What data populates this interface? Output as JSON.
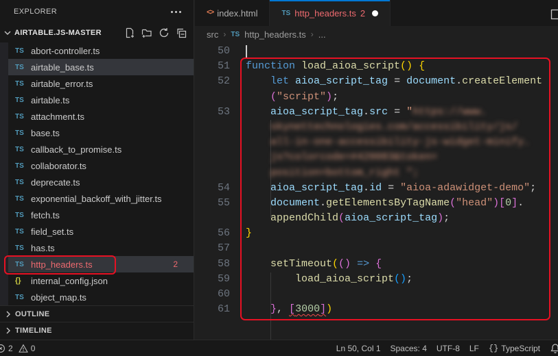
{
  "explorer": {
    "title": "EXPLORER",
    "workspace": "AIRTABLE.JS-MASTER",
    "toolbar_icons": [
      "new-file-icon",
      "new-folder-icon",
      "refresh-icon",
      "collapse-all-icon"
    ],
    "files": [
      {
        "name": "abort-controller.ts",
        "type": "ts"
      },
      {
        "name": "airtable_base.ts",
        "type": "ts",
        "selected": true
      },
      {
        "name": "airtable_error.ts",
        "type": "ts"
      },
      {
        "name": "airtable.ts",
        "type": "ts"
      },
      {
        "name": "attachment.ts",
        "type": "ts"
      },
      {
        "name": "base.ts",
        "type": "ts"
      },
      {
        "name": "callback_to_promise.ts",
        "type": "ts"
      },
      {
        "name": "collaborator.ts",
        "type": "ts"
      },
      {
        "name": "deprecate.ts",
        "type": "ts"
      },
      {
        "name": "exponential_backoff_with_jitter.ts",
        "type": "ts"
      },
      {
        "name": "fetch.ts",
        "type": "ts"
      },
      {
        "name": "field_set.ts",
        "type": "ts"
      },
      {
        "name": "has.ts",
        "type": "ts"
      },
      {
        "name": "http_headers.ts",
        "type": "ts",
        "selected": true,
        "error": true,
        "badge": "2",
        "annotated": true
      },
      {
        "name": "internal_config.json",
        "type": "json"
      },
      {
        "name": "object_map.ts",
        "type": "ts"
      }
    ],
    "sections": [
      {
        "label": "OUTLINE"
      },
      {
        "label": "TIMELINE"
      }
    ]
  },
  "tabs": [
    {
      "label": "index.html",
      "file_type": "html",
      "active": false
    },
    {
      "label": "http_headers.ts",
      "file_type": "ts",
      "badge": "2",
      "active": true,
      "has_errors": true,
      "modified": true
    }
  ],
  "breadcrumb": {
    "items": [
      "src",
      "http_headers.ts",
      "..."
    ]
  },
  "editor": {
    "cursor_line": "50",
    "rows": [
      {
        "n": "50",
        "segs": []
      },
      {
        "n": "51",
        "segs": [
          {
            "t": "function ",
            "c": "kw"
          },
          {
            "t": "load_aioa_script",
            "c": "fn"
          },
          {
            "t": "()",
            "c": "b1"
          },
          {
            "t": " ",
            "c": "p"
          },
          {
            "t": "{",
            "c": "b1"
          }
        ]
      },
      {
        "n": "52",
        "segs": [
          {
            "t": "    ",
            "c": "p"
          },
          {
            "t": "let ",
            "c": "kw"
          },
          {
            "t": "aioa_script_tag",
            "c": "var"
          },
          {
            "t": " = ",
            "c": "p"
          },
          {
            "t": "document",
            "c": "var"
          },
          {
            "t": ".",
            "c": "p"
          },
          {
            "t": "createElement",
            "c": "fn"
          }
        ]
      },
      {
        "n": "",
        "segs": [
          {
            "t": "    ",
            "c": "p"
          },
          {
            "t": "(",
            "c": "b2"
          },
          {
            "t": "\"script\"",
            "c": "str"
          },
          {
            "t": ")",
            "c": "b2"
          },
          {
            "t": ";",
            "c": "p"
          }
        ]
      },
      {
        "n": "53",
        "segs": [
          {
            "t": "    ",
            "c": "p"
          },
          {
            "t": "aioa_script_tag",
            "c": "var"
          },
          {
            "t": ".",
            "c": "p"
          },
          {
            "t": "src",
            "c": "var"
          },
          {
            "t": " = ",
            "c": "p"
          },
          {
            "t": "\"",
            "c": "str"
          },
          {
            "t": "https://www.",
            "c": "str",
            "blur": true
          }
        ]
      },
      {
        "n": "",
        "segs": [
          {
            "t": "    ",
            "c": "p"
          },
          {
            "t": "skynettechnologies.com/accessibility/js/",
            "c": "str",
            "blur": true
          }
        ]
      },
      {
        "n": "",
        "segs": [
          {
            "t": "    ",
            "c": "p"
          },
          {
            "t": "all-in-one-accessibility-js-widget-minify.",
            "c": "str",
            "blur": true
          }
        ]
      },
      {
        "n": "",
        "segs": [
          {
            "t": "    ",
            "c": "p"
          },
          {
            "t": "js?colorcode=#420083&token=",
            "c": "str",
            "blur": true
          }
        ]
      },
      {
        "n": "",
        "segs": [
          {
            "t": "    ",
            "c": "p"
          },
          {
            "t": "position=bottom_right",
            "c": "str",
            "blur": true
          },
          {
            "t": " ",
            "c": "p"
          },
          {
            "t": "\";",
            "c": "str",
            "blur": true
          }
        ]
      },
      {
        "n": "54",
        "segs": [
          {
            "t": "    ",
            "c": "p"
          },
          {
            "t": "aioa_script_tag",
            "c": "var"
          },
          {
            "t": ".",
            "c": "p"
          },
          {
            "t": "id",
            "c": "var"
          },
          {
            "t": " = ",
            "c": "p"
          },
          {
            "t": "\"aioa-adawidget-demo\"",
            "c": "str"
          },
          {
            "t": ";",
            "c": "p"
          }
        ]
      },
      {
        "n": "55",
        "segs": [
          {
            "t": "    ",
            "c": "p"
          },
          {
            "t": "document",
            "c": "var"
          },
          {
            "t": ".",
            "c": "p"
          },
          {
            "t": "getElementsByTagName",
            "c": "fn"
          },
          {
            "t": "(",
            "c": "b2"
          },
          {
            "t": "\"head\"",
            "c": "str"
          },
          {
            "t": ")",
            "c": "b2"
          },
          {
            "t": "[",
            "c": "b2"
          },
          {
            "t": "0",
            "c": "num"
          },
          {
            "t": "]",
            "c": "b2"
          },
          {
            "t": ".",
            "c": "p"
          }
        ]
      },
      {
        "n": "",
        "segs": [
          {
            "t": "    ",
            "c": "p"
          },
          {
            "t": "appendChild",
            "c": "fn"
          },
          {
            "t": "(",
            "c": "b2"
          },
          {
            "t": "aioa_script_tag",
            "c": "var"
          },
          {
            "t": ")",
            "c": "b2"
          },
          {
            "t": ";",
            "c": "p"
          }
        ]
      },
      {
        "n": "56",
        "segs": [
          {
            "t": "}",
            "c": "b1"
          }
        ]
      },
      {
        "n": "57",
        "segs": []
      },
      {
        "n": "58",
        "segs": [
          {
            "t": "    ",
            "c": "p"
          },
          {
            "t": "setTimeout",
            "c": "fn"
          },
          {
            "t": "(",
            "c": "b1"
          },
          {
            "t": "()",
            "c": "b2"
          },
          {
            "t": " ",
            "c": "p"
          },
          {
            "t": "=>",
            "c": "kw"
          },
          {
            "t": " ",
            "c": "p"
          },
          {
            "t": "{",
            "c": "b2"
          }
        ]
      },
      {
        "n": "59",
        "segs": [
          {
            "t": "        ",
            "c": "p"
          },
          {
            "t": "load_aioa_script",
            "c": "fn"
          },
          {
            "t": "()",
            "c": "b3"
          },
          {
            "t": ";",
            "c": "p"
          }
        ]
      },
      {
        "n": "60",
        "segs": []
      },
      {
        "n": "61",
        "segs": [
          {
            "t": "    ",
            "c": "p"
          },
          {
            "t": "}",
            "c": "b2"
          },
          {
            "t": ", ",
            "c": "p"
          },
          {
            "t": "[",
            "c": "b2",
            "sq": true
          },
          {
            "t": "3000",
            "c": "num",
            "sq": true
          },
          {
            "t": "]",
            "c": "b2",
            "sq": true
          },
          {
            "t": ")",
            "c": "b1"
          }
        ]
      }
    ]
  },
  "status_bar": {
    "problems": {
      "errors": "2",
      "warnings": "0"
    },
    "cursor_position": "Ln 50, Col 1",
    "indentation": "Spaces: 4",
    "encoding": "UTF-8",
    "eol": "LF",
    "language": "TypeScript",
    "language_icon": "{}"
  },
  "colors": {
    "annotation_red": "#e81123",
    "error_text": "#ee6a6f",
    "accent_tab": "#0078d4",
    "ts_icon": "#519aba",
    "json_icon": "#cbcb41"
  }
}
